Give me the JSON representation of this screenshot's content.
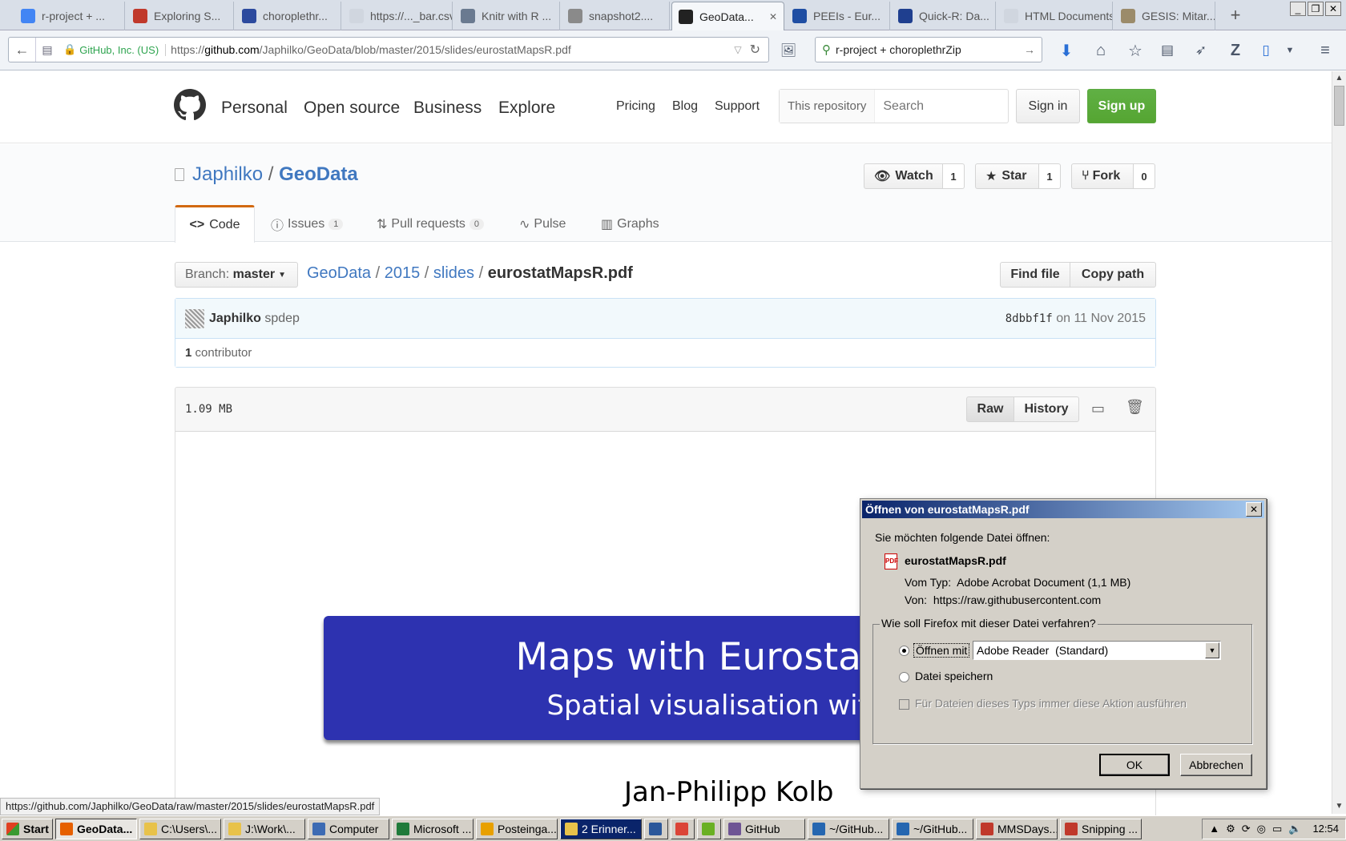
{
  "browser": {
    "tabs": [
      {
        "label": "r-project + ...",
        "icon": "google-icon",
        "color": "#4285f4"
      },
      {
        "label": "Exploring S...",
        "icon": "r-icon",
        "color": "#c0392b"
      },
      {
        "label": "choroplethr...",
        "icon": "grid-icon",
        "color": "#2c4a9e"
      },
      {
        "label": "https://..._bar.csv",
        "icon": "blank-icon",
        "color": "#d0d6df"
      },
      {
        "label": "Knitr with R ...",
        "icon": "doc-icon",
        "color": "#6a7a90"
      },
      {
        "label": "snapshot2....",
        "icon": "page-icon",
        "color": "#8a8a8a"
      },
      {
        "label": "GeoData...",
        "icon": "github-icon",
        "color": "#222"
      },
      {
        "label": "PEEIs - Eur...",
        "icon": "eurostat-icon",
        "color": "#1f4ea3"
      },
      {
        "label": "Quick-R: Da...",
        "icon": "r-icon",
        "color": "#1f3f8f"
      },
      {
        "label": "HTML Documents",
        "icon": "blank-icon",
        "color": "#d0d6df"
      },
      {
        "label": "GESIS: Mitar...",
        "icon": "gesis-icon",
        "color": "#9b8b6a"
      }
    ],
    "identity": "GitHub, Inc. (US)",
    "url_prefix": "https://",
    "url_host": "github.com",
    "url_path": "/Japhilko/GeoData/blob/master/2015/slides/eurostatMapsR.pdf",
    "search_value": "r-project + choroplethrZip",
    "status_url": "https://github.com/Japhilko/GeoData/raw/master/2015/slides/eurostatMapsR.pdf"
  },
  "github": {
    "nav": [
      "Personal",
      "Open source",
      "Business",
      "Explore"
    ],
    "subnav": [
      "Pricing",
      "Blog",
      "Support"
    ],
    "search_scope": "This repository",
    "search_placeholder": "Search",
    "signin": "Sign in",
    "signup": "Sign up"
  },
  "repo": {
    "owner": "Japhilko",
    "sep": "/",
    "name": "GeoData",
    "watch": "Watch",
    "watch_count": "1",
    "star": "Star",
    "star_count": "1",
    "fork": "Fork",
    "fork_count": "0",
    "tabs": [
      {
        "label": "Code"
      },
      {
        "label": "Issues",
        "count": "1"
      },
      {
        "label": "Pull requests",
        "count": "0"
      },
      {
        "label": "Pulse"
      },
      {
        "label": "Graphs"
      }
    ]
  },
  "file": {
    "branch_label": "Branch:",
    "branch": "master",
    "path": [
      "GeoData",
      "2015",
      "slides"
    ],
    "filename": "eurostatMapsR.pdf",
    "find_file": "Find file",
    "copy_path": "Copy path",
    "commit_author": "Japhilko",
    "commit_msg": "spdep",
    "commit_sha": "8dbbf1f",
    "commit_date": "on 11 Nov 2015",
    "contributors_count": "1",
    "contributors_label": "contributor",
    "size": "1.09 MB",
    "raw": "Raw",
    "history": "History"
  },
  "pdf": {
    "title": "Maps with Eurostat D",
    "subtitle": "Spatial visualisation with",
    "author": "Jan-Philipp Kolb",
    "banner_color": "#2d32b0"
  },
  "dialog": {
    "title": "Öffnen von eurostatMapsR.pdf",
    "intro": "Sie möchten folgende Datei öffnen:",
    "filename": "eurostatMapsR.pdf",
    "type_label": "Vom Typ:",
    "type_value": "Adobe Acrobat Document (1,1 MB)",
    "from_label": "Von:",
    "from_value": "https://raw.githubusercontent.com",
    "group_label": "Wie soll Firefox mit dieser Datei verfahren?",
    "open_with": "Öffnen mit",
    "open_with_app": "Adobe Reader  (Standard)",
    "save": "Datei speichern",
    "always": "Für Dateien dieses Typs immer diese Aktion ausführen",
    "ok": "OK",
    "cancel": "Abbrechen"
  },
  "taskbar": {
    "start": "Start",
    "items": [
      {
        "label": "GeoData...",
        "color": "#e66000",
        "active": true
      },
      {
        "label": "C:\\Users\\...",
        "color": "#e8c24a"
      },
      {
        "label": "J:\\Work\\...",
        "color": "#e8c24a"
      },
      {
        "label": "Computer",
        "color": "#3d6bb3"
      },
      {
        "label": "Microsoft ...",
        "color": "#1f7a3a"
      },
      {
        "label": "Posteinga...",
        "color": "#e8a000"
      },
      {
        "label": "2 Erinner...",
        "color": "#e8c24a",
        "hl": true
      },
      {
        "label": "",
        "color": "#2b579a"
      },
      {
        "label": "",
        "color": "#db4437"
      },
      {
        "label": "",
        "color": "#6ab023"
      },
      {
        "label": "GitHub",
        "color": "#6e5494"
      },
      {
        "label": "~/GitHub...",
        "color": "#2566b0"
      },
      {
        "label": "~/GitHub...",
        "color": "#2566b0"
      },
      {
        "label": "MMSDays...",
        "color": "#c0392b"
      },
      {
        "label": "Snipping ...",
        "color": "#c0392b"
      }
    ],
    "clock": "12:54"
  }
}
